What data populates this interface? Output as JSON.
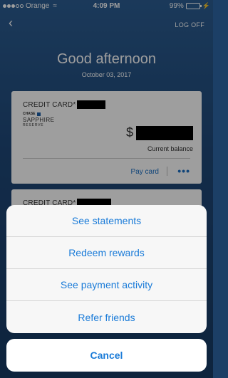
{
  "status_bar": {
    "carrier": "Orange",
    "time": "4:09 PM",
    "battery": "99%",
    "battery_level": 0.99
  },
  "nav": {
    "back_icon": "chevron-left-icon",
    "logoff_label": "LOG OFF"
  },
  "header": {
    "greeting": "Good afternoon",
    "date": "October 03, 2017"
  },
  "accounts": [
    {
      "title": "CREDIT CARD*",
      "brand_line1": "CHASE",
      "brand_line2": "SAPPHIRE",
      "brand_line3": "RESERVE",
      "currency": "$",
      "balance_label": "Current balance",
      "pay_label": "Pay card",
      "more_label": "•••"
    },
    {
      "title": "CREDIT CARD*"
    }
  ],
  "action_sheet": {
    "items": [
      "See statements",
      "Redeem rewards",
      "See payment activity",
      "Refer friends"
    ],
    "cancel_label": "Cancel"
  },
  "colors": {
    "accent": "#1a7bd8",
    "background": "#1f4878"
  }
}
